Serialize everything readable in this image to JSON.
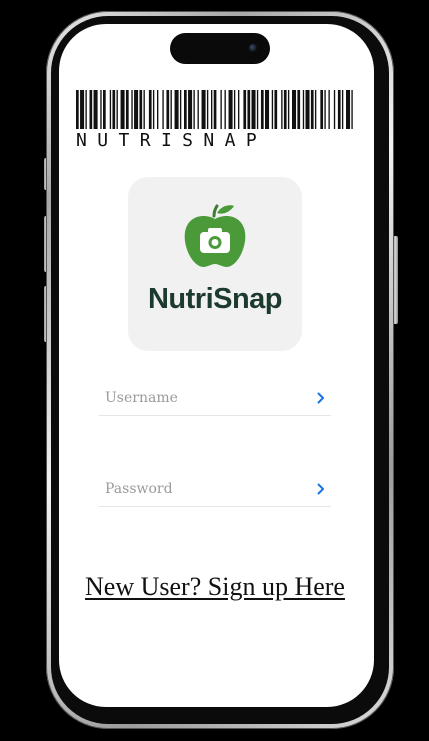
{
  "header": {
    "barcode_text": "NUTRISNAP"
  },
  "logo": {
    "wordmark": "NutriSnap",
    "icon": "apple-camera-icon",
    "brand_green": "#4a9a3a",
    "text_color": "#1d3a2e"
  },
  "form": {
    "username": {
      "placeholder": "Username",
      "value": ""
    },
    "password": {
      "placeholder": "Password",
      "value": ""
    },
    "chevron_icon": "chevron-right-icon",
    "chevron_color": "#1a73e8"
  },
  "signup": {
    "label": "New User? Sign up Here"
  }
}
